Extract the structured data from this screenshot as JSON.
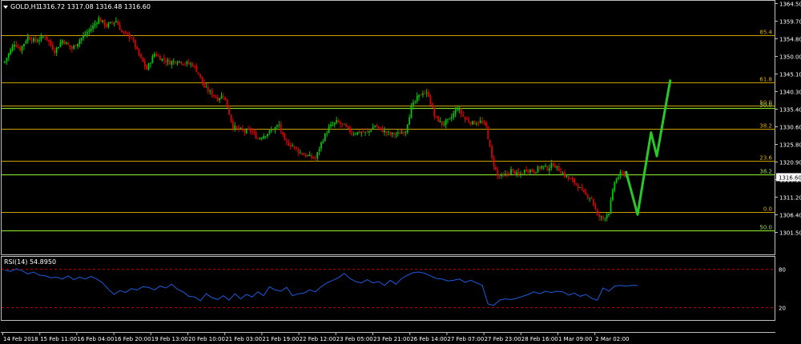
{
  "header": {
    "symbol_timeframe": "GOLD,H1",
    "ohlc": "1316.72 1317.08 1316.48 1316.60",
    "menu_icon": "triangle-down-icon"
  },
  "price_axis": {
    "ticks": [
      "1364.50",
      "1359.70",
      "1354.80",
      "1350.00",
      "1345.10",
      "1340.30",
      "1335.40",
      "1330.60",
      "1325.80",
      "1320.90",
      "1316.10",
      "1311.20",
      "1306.40",
      "1301.50"
    ],
    "current_price": "1316.60"
  },
  "fib_yellow": [
    {
      "label": "85.4",
      "price": 1355.6
    },
    {
      "label": "61.8",
      "price": 1342.8
    },
    {
      "label": "50.0",
      "price": 1336.3
    },
    {
      "label": "38.2",
      "price": 1329.9
    },
    {
      "label": "23.6",
      "price": 1321.0
    },
    {
      "label": "0.0",
      "price": 1307.0
    }
  ],
  "fib_green": [
    {
      "label": "50.0",
      "price": 1335.6
    },
    {
      "label": "38.2",
      "price": 1317.4
    },
    {
      "label": "50.0",
      "price": 1301.9
    }
  ],
  "rsi": {
    "title": "RSI(14) 54.8950",
    "levels": [
      {
        "label": "80",
        "value": 80
      },
      {
        "label": "20",
        "value": 20
      }
    ]
  },
  "time_axis": {
    "labels": [
      "14 Feb 2018",
      "15 Feb 11:00",
      "16 Feb 04:00",
      "16 Feb 20:00",
      "19 Feb 13:00",
      "20 Feb 10:00",
      "21 Feb 03:00",
      "21 Feb 19:00",
      "22 Feb 12:00",
      "23 Feb 05:00",
      "23 Feb 21:00",
      "26 Feb 14:00",
      "27 Feb 07:00",
      "27 Feb 23:00",
      "28 Feb 16:00",
      "1 Mar 09:00",
      "2 Mar 02:00"
    ]
  },
  "colors": {
    "background": "#000000",
    "grid_frame": "#c0c0c0",
    "bull": "#00c800",
    "bear": "#e00000",
    "fib_yellow": "#c8a000",
    "fib_green": "#7fd42a",
    "fib_label_yellow": "#e0b000",
    "fib_label_green": "#9ee050",
    "projection": "#28c828",
    "rsi_line": "#1e5adc",
    "rsi_level": "#c00000"
  },
  "chart_data": {
    "type": "candlestick",
    "price_ylim": [
      1300.5,
      1366.0
    ],
    "rsi_ylim": [
      0,
      100
    ],
    "close_path": [
      [
        0,
        1348.5
      ],
      [
        5,
        1353.5
      ],
      [
        8,
        1351.8
      ],
      [
        12,
        1355.2
      ],
      [
        16,
        1354.0
      ],
      [
        21,
        1355.5
      ],
      [
        26,
        1351.3
      ],
      [
        30,
        1354.3
      ],
      [
        35,
        1352.0
      ],
      [
        40,
        1354.9
      ],
      [
        45,
        1357.5
      ],
      [
        49,
        1360.2
      ],
      [
        53,
        1358.3
      ],
      [
        58,
        1359.7
      ],
      [
        61,
        1356.5
      ],
      [
        66,
        1355.1
      ],
      [
        70,
        1350.2
      ],
      [
        74,
        1346.3
      ],
      [
        78,
        1350.6
      ],
      [
        82,
        1349.1
      ],
      [
        86,
        1348.2
      ],
      [
        90,
        1348.7
      ],
      [
        94,
        1348.0
      ],
      [
        98,
        1347.6
      ],
      [
        101,
        1345.2
      ],
      [
        104,
        1341.4
      ],
      [
        107,
        1340.0
      ],
      [
        111,
        1338.2
      ],
      [
        114,
        1339.3
      ],
      [
        116,
        1336.0
      ],
      [
        119,
        1330.5
      ],
      [
        122,
        1329.8
      ],
      [
        125,
        1329.1
      ],
      [
        128,
        1329.5
      ],
      [
        132,
        1327.2
      ],
      [
        136,
        1328.4
      ],
      [
        140,
        1329.7
      ],
      [
        143,
        1331.0
      ],
      [
        146,
        1326.2
      ],
      [
        150,
        1325.3
      ],
      [
        154,
        1323.3
      ],
      [
        158,
        1322.4
      ],
      [
        162,
        1321.7
      ],
      [
        165,
        1326.0
      ],
      [
        169,
        1330.2
      ],
      [
        173,
        1331.8
      ],
      [
        177,
        1330.7
      ],
      [
        181,
        1328.7
      ],
      [
        185,
        1329.0
      ],
      [
        189,
        1328.8
      ],
      [
        193,
        1330.8
      ],
      [
        197,
        1329.4
      ],
      [
        201,
        1328.4
      ],
      [
        205,
        1328.5
      ],
      [
        209,
        1329.5
      ],
      [
        212,
        1335.8
      ],
      [
        215,
        1338.3
      ],
      [
        218,
        1340.0
      ],
      [
        221,
        1339.3
      ],
      [
        224,
        1333.4
      ],
      [
        228,
        1331.2
      ],
      [
        232,
        1332.3
      ],
      [
        236,
        1335.6
      ],
      [
        240,
        1332.6
      ],
      [
        244,
        1331.5
      ],
      [
        248,
        1331.9
      ],
      [
        251,
        1330.5
      ],
      [
        254,
        1321.6
      ],
      [
        257,
        1317.0
      ],
      [
        260,
        1316.7
      ],
      [
        264,
        1318.5
      ],
      [
        268,
        1317.1
      ],
      [
        272,
        1318.8
      ],
      [
        276,
        1318.2
      ],
      [
        280,
        1319.6
      ],
      [
        283,
        1319.0
      ],
      [
        286,
        1320.2
      ],
      [
        290,
        1318.1
      ],
      [
        294,
        1316.2
      ],
      [
        298,
        1314.8
      ],
      [
        302,
        1312.0
      ],
      [
        306,
        1310.8
      ],
      [
        309,
        1306.0
      ],
      [
        312,
        1305.2
      ],
      [
        315,
        1307.0
      ],
      [
        318,
        1315.3
      ],
      [
        321,
        1317.5
      ],
      [
        324,
        1317.3
      ]
    ],
    "projection_path": [
      [
        324,
        1318.0
      ],
      [
        330,
        1306.3
      ],
      [
        337,
        1328.9
      ],
      [
        340,
        1322.4
      ],
      [
        347,
        1343.2
      ]
    ],
    "rsi_path": [
      [
        0,
        78
      ],
      [
        3,
        76
      ],
      [
        6,
        80
      ],
      [
        9,
        77
      ],
      [
        12,
        72
      ],
      [
        15,
        75
      ],
      [
        18,
        70
      ],
      [
        21,
        69
      ],
      [
        24,
        66
      ],
      [
        27,
        67
      ],
      [
        30,
        64
      ],
      [
        33,
        69
      ],
      [
        36,
        63
      ],
      [
        39,
        67
      ],
      [
        42,
        64
      ],
      [
        45,
        68
      ],
      [
        48,
        64
      ],
      [
        51,
        58
      ],
      [
        54,
        48
      ],
      [
        57,
        40
      ],
      [
        60,
        46
      ],
      [
        63,
        43
      ],
      [
        66,
        49
      ],
      [
        69,
        47
      ],
      [
        72,
        52
      ],
      [
        75,
        51
      ],
      [
        78,
        47
      ],
      [
        81,
        53
      ],
      [
        84,
        50
      ],
      [
        87,
        56
      ],
      [
        90,
        48
      ],
      [
        93,
        44
      ],
      [
        96,
        37
      ],
      [
        99,
        36
      ],
      [
        102,
        30
      ],
      [
        105,
        41
      ],
      [
        108,
        35
      ],
      [
        111,
        32
      ],
      [
        114,
        38
      ],
      [
        117,
        31
      ],
      [
        120,
        41
      ],
      [
        123,
        33
      ],
      [
        126,
        40
      ],
      [
        129,
        36
      ],
      [
        132,
        44
      ],
      [
        135,
        38
      ],
      [
        138,
        52
      ],
      [
        141,
        47
      ],
      [
        144,
        45
      ],
      [
        147,
        51
      ],
      [
        150,
        38
      ],
      [
        153,
        41
      ],
      [
        156,
        42
      ],
      [
        159,
        47
      ],
      [
        162,
        44
      ],
      [
        165,
        52
      ],
      [
        168,
        58
      ],
      [
        171,
        62
      ],
      [
        174,
        66
      ],
      [
        177,
        73
      ],
      [
        180,
        65
      ],
      [
        183,
        60
      ],
      [
        186,
        58
      ],
      [
        189,
        63
      ],
      [
        192,
        58
      ],
      [
        195,
        60
      ],
      [
        198,
        54
      ],
      [
        201,
        62
      ],
      [
        204,
        56
      ],
      [
        207,
        65
      ],
      [
        210,
        70
      ],
      [
        213,
        74
      ],
      [
        216,
        75
      ],
      [
        219,
        73
      ],
      [
        222,
        69
      ],
      [
        225,
        65
      ],
      [
        228,
        64
      ],
      [
        231,
        61
      ],
      [
        234,
        62
      ],
      [
        237,
        64
      ],
      [
        240,
        59
      ],
      [
        243,
        62
      ],
      [
        246,
        58
      ],
      [
        249,
        54
      ],
      [
        252,
        25
      ],
      [
        255,
        23
      ],
      [
        258,
        31
      ],
      [
        261,
        33
      ],
      [
        264,
        32
      ],
      [
        267,
        34
      ],
      [
        270,
        37
      ],
      [
        273,
        40
      ],
      [
        276,
        44
      ],
      [
        279,
        41
      ],
      [
        282,
        45
      ],
      [
        285,
        43
      ],
      [
        288,
        45
      ],
      [
        291,
        44
      ],
      [
        294,
        39
      ],
      [
        297,
        42
      ],
      [
        300,
        37
      ],
      [
        303,
        40
      ],
      [
        306,
        34
      ],
      [
        309,
        31
      ],
      [
        312,
        50
      ],
      [
        315,
        45
      ],
      [
        318,
        53
      ],
      [
        321,
        54
      ],
      [
        324,
        53
      ],
      [
        327,
        54
      ],
      [
        330,
        54
      ]
    ]
  }
}
